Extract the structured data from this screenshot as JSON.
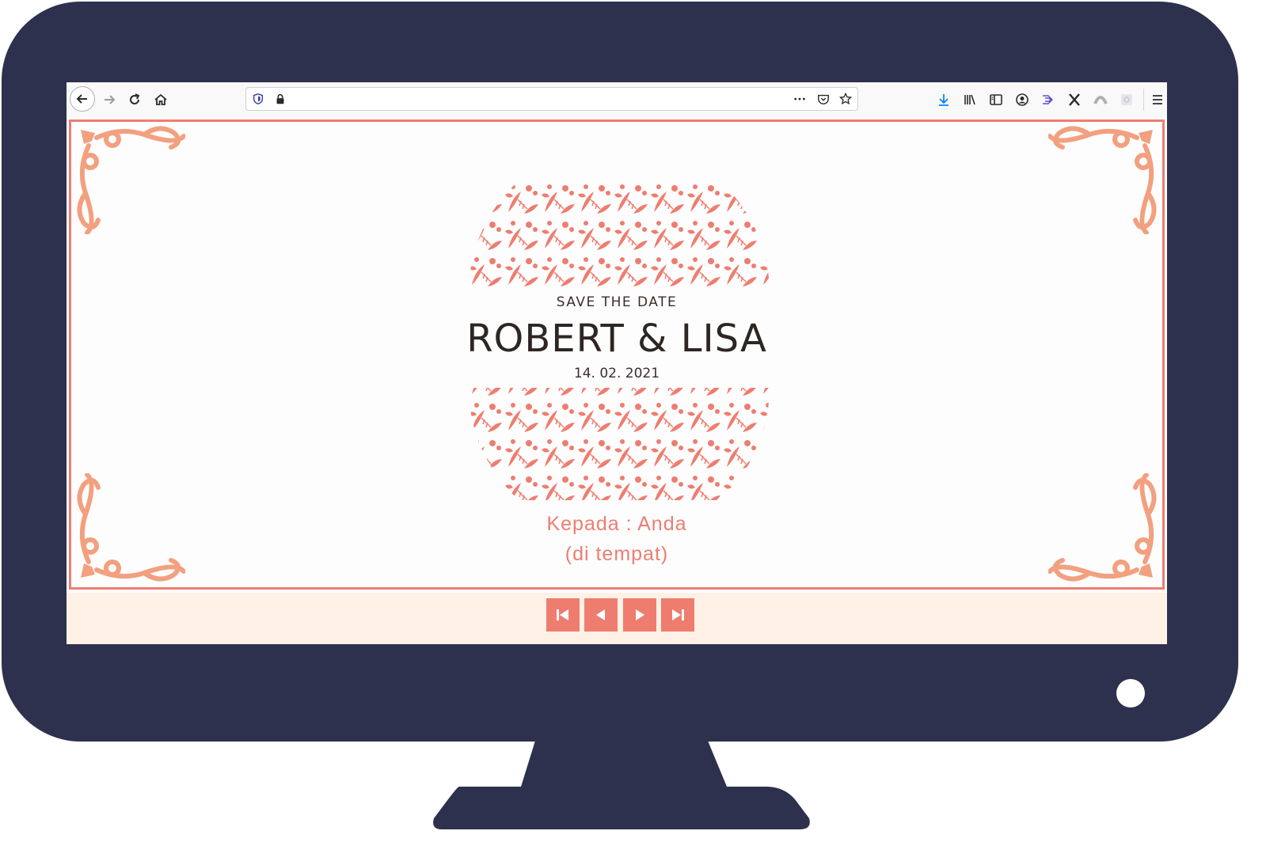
{
  "browser": {
    "url": "",
    "toolbar_icons": [
      "back-icon",
      "forward-icon",
      "reload-icon",
      "home-icon",
      "shield-icon",
      "lock-icon",
      "more-icon",
      "pocket-icon",
      "star-icon",
      "download-icon",
      "library-icon",
      "sidebar-icon",
      "account-icon",
      "send-icon",
      "x-icon",
      "extension-icon",
      "extension2-icon",
      "menu-icon"
    ]
  },
  "invitation": {
    "heading": "SAVE THE DATE",
    "names": "ROBERT & LISA",
    "date": "14. 02. 2021",
    "recipient": "Kepada : Anda",
    "recipient_place": "(di tempat)"
  },
  "nav": {
    "buttons": [
      "first-page",
      "previous-page",
      "next-page",
      "last-page"
    ]
  },
  "colors": {
    "monitor": "#2d314d",
    "accent": "#ee7d70",
    "nav_background": "#fff1e6",
    "ornament": "#f2a07f"
  }
}
